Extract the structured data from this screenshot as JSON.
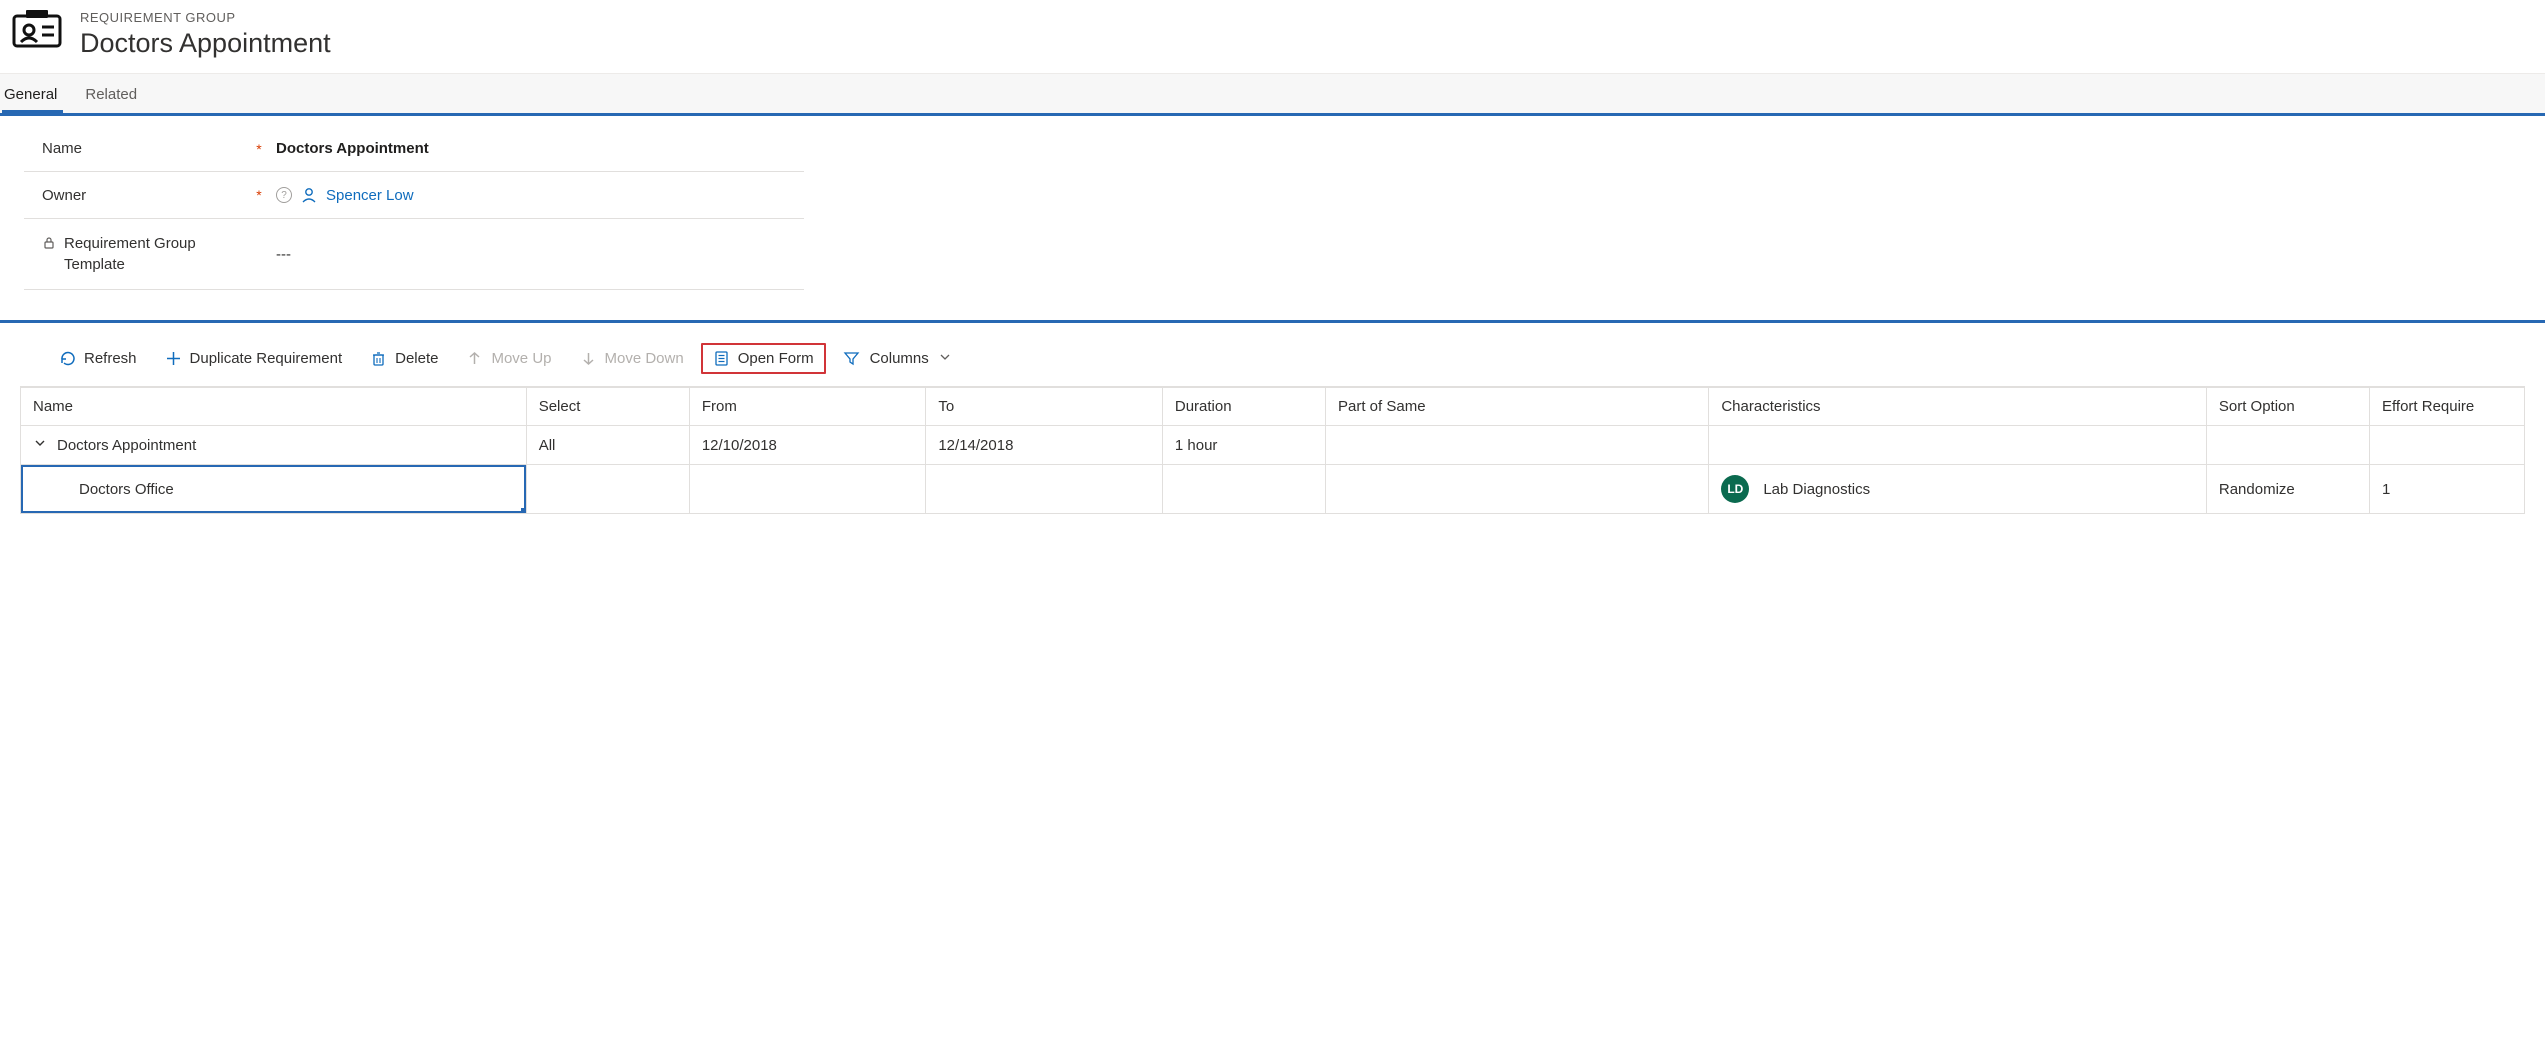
{
  "header": {
    "eyebrow": "REQUIREMENT GROUP",
    "title": "Doctors Appointment"
  },
  "tabs": {
    "general": "General",
    "related": "Related"
  },
  "form": {
    "name_label": "Name",
    "name_value": "Doctors Appointment",
    "owner_label": "Owner",
    "owner_value": "Spencer Low",
    "template_label": "Requirement Group Template",
    "template_value": "---"
  },
  "toolbar": {
    "refresh": "Refresh",
    "duplicate": "Duplicate Requirement",
    "delete": "Delete",
    "moveup": "Move Up",
    "movedown": "Move Down",
    "openform": "Open Form",
    "columns": "Columns"
  },
  "grid": {
    "headers": {
      "name": "Name",
      "select": "Select",
      "from": "From",
      "to": "To",
      "duration": "Duration",
      "part": "Part of Same",
      "characteristics": "Characteristics",
      "sort": "Sort Option",
      "effort": "Effort Require"
    },
    "rows": [
      {
        "name": "Doctors Appointment",
        "select": "All",
        "from": "12/10/2018",
        "to": "12/14/2018",
        "duration": "1 hour",
        "part": "",
        "char_initials": "",
        "char_label": "",
        "sort": "",
        "effort": ""
      },
      {
        "name": "Doctors Office",
        "select": "",
        "from": "",
        "to": "",
        "duration": "",
        "part": "",
        "char_initials": "LD",
        "char_label": "Lab Diagnostics",
        "sort": "Randomize",
        "effort": "1"
      }
    ]
  }
}
